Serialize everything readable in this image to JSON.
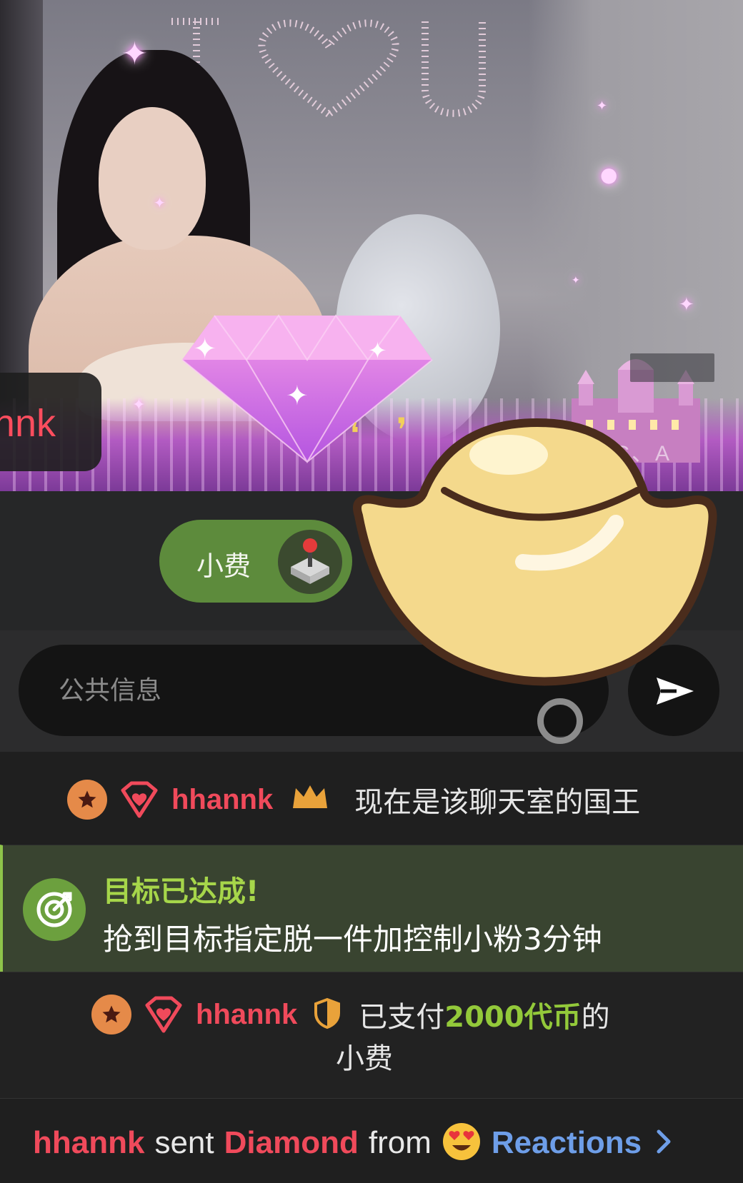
{
  "stream": {
    "overlay_username": "nnk",
    "watermark": "TRIPC、A",
    "neon_sign": "I ♥ U"
  },
  "tip_button": {
    "label": "小费"
  },
  "input": {
    "placeholder": "公共信息",
    "value": ""
  },
  "chat": {
    "king_message": {
      "username": "hhannk",
      "text": "现在是该聊天室的国王"
    },
    "goal": {
      "title": "目标已达成!",
      "description": "抢到目标指定脱一件加控制小粉3分钟"
    },
    "tip_message": {
      "username": "hhannk",
      "prefix": "已支付",
      "amount": "2000代币",
      "suffix": "的",
      "line2": "小费"
    },
    "reaction_message": {
      "username": "hhannk",
      "sent": "sent",
      "gift": "Diamond",
      "from": "from",
      "source": "Reactions"
    }
  },
  "colors": {
    "username_red": "#f04a5b",
    "tip_green": "#5d8b3c",
    "goal_green": "#a6d64a",
    "amount_green": "#93c93a",
    "reactions_blue": "#6e9ee8"
  }
}
